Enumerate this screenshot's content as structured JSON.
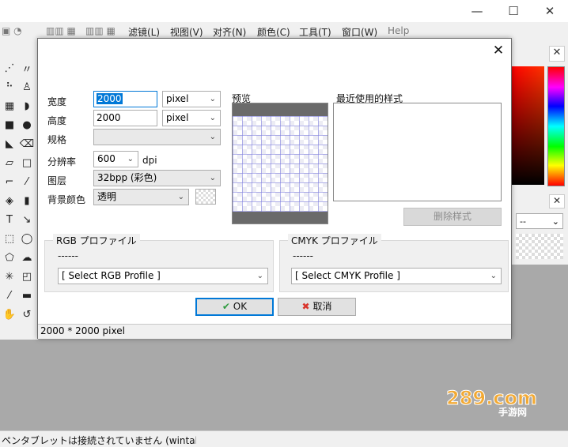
{
  "window": {
    "minimize": "—",
    "maximize": "☐",
    "close": "✕"
  },
  "menu": {
    "items": [
      "滤镜(L)",
      "视图(V)",
      "对齐(N)",
      "颜色(C)",
      "工具(T)",
      "窗口(W)",
      "Help"
    ]
  },
  "dialog": {
    "close": "✕",
    "width_label": "宽度",
    "width_value": "2000",
    "width_unit": "pixel",
    "height_label": "高度",
    "height_value": "2000",
    "height_unit": "pixel",
    "spec_label": "规格",
    "spec_value": "",
    "dpi_label": "分辨率",
    "dpi_value": "600",
    "dpi_unit": "dpi",
    "layer_label": "图层",
    "layer_value": "32bpp (彩色)",
    "bg_label": "背景颜色",
    "bg_value": "透明",
    "preview_label": "预览",
    "recent_label": "最近使用的样式",
    "delete_style": "删除样式",
    "rgb_profile_title": "RGB プロファイル",
    "rgb_profile_name": "------",
    "rgb_profile_select": "[ Select RGB Profile ]",
    "cmyk_profile_title": "CMYK プロファイル",
    "cmyk_profile_name": "------",
    "cmyk_profile_select": "[ Select CMYK Profile ]",
    "ok": "OK",
    "cancel": "取消",
    "status": "2000 * 2000 pixel"
  },
  "right_panel": {
    "select_value": "--"
  },
  "statusbar": {
    "text": "ペンタブレットは接続されていません (wintab"
  },
  "watermark": {
    "logo": "289.com",
    "sub": "手游网"
  },
  "colors": {
    "accent": "#0078d7",
    "ok_icon": "#2e9b3e",
    "cancel_icon": "#d9342b",
    "workspace": "#a9a9a9"
  }
}
